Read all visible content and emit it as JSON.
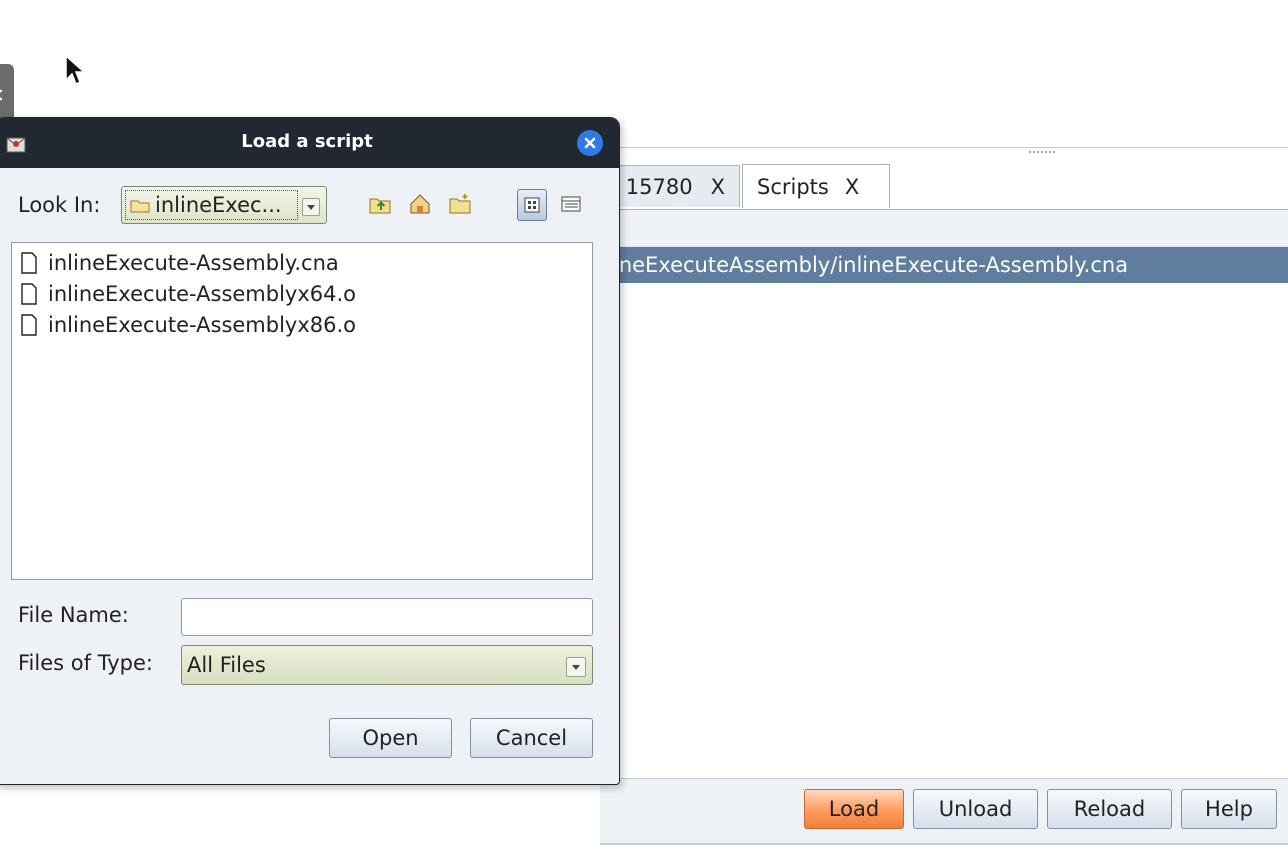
{
  "background_window": {
    "tabs": [
      {
        "label": "15780",
        "close": "X"
      },
      {
        "label": "Scripts",
        "close": "X"
      }
    ],
    "script_row": "inlineExecuteAssembly/inlineExecute-Assembly.cna",
    "buttons": {
      "load": "Load",
      "unload": "Unload",
      "reload": "Reload",
      "help": "Help"
    }
  },
  "dialog": {
    "title": "Load a script",
    "look_in_label": "Look In:",
    "look_in_value": "inlineExec...",
    "files": [
      "inlineExecute-Assembly.cna",
      "inlineExecute-Assemblyx64.o",
      "inlineExecute-Assemblyx86.o"
    ],
    "file_name_label": "File Name:",
    "file_name_value": "",
    "files_of_type_label": "Files of Type:",
    "files_of_type_value": "All Files",
    "open_label": "Open",
    "cancel_label": "Cancel"
  },
  "icons": [
    "folder-icon",
    "up-folder-icon",
    "home-icon",
    "new-folder-icon",
    "list-view-icon",
    "details-view-icon",
    "file-icon",
    "close-icon",
    "app-icon",
    "mouse-cursor-icon"
  ],
  "colors": {
    "titlebar": "#222831",
    "selection": "#5f7d9d",
    "load_button": "#ff9a5c",
    "close_button": "#2f7ae5"
  }
}
